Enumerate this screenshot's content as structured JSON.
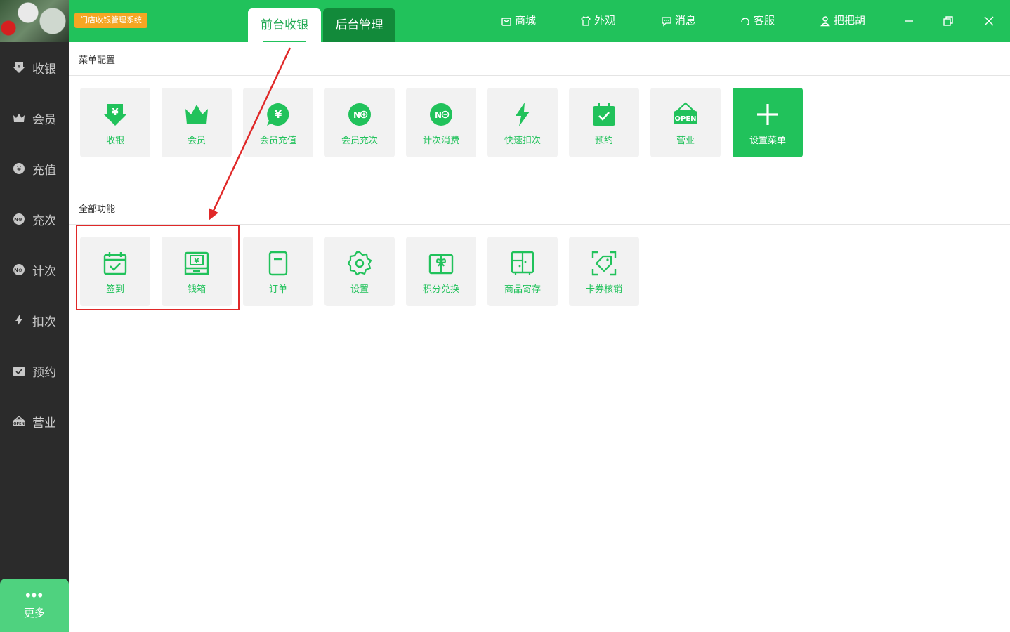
{
  "header": {
    "app_badge": "门店收银管理系统",
    "tabs": [
      {
        "label": "前台收银",
        "active": true
      },
      {
        "label": "后台管理",
        "active": false
      }
    ],
    "nav": [
      {
        "label": "商城",
        "icon": "bag-icon"
      },
      {
        "label": "外观",
        "icon": "shirt-icon"
      },
      {
        "label": "消息",
        "icon": "chat-icon"
      },
      {
        "label": "客服",
        "icon": "headset-icon"
      },
      {
        "label": "把把胡",
        "icon": "user-icon"
      }
    ]
  },
  "sidebar": {
    "items": [
      {
        "label": "收银",
        "icon": "cash-down-icon"
      },
      {
        "label": "会员",
        "icon": "crown-icon"
      },
      {
        "label": "充值",
        "icon": "yuan-circle-icon"
      },
      {
        "label": "充次",
        "icon": "no-plus-icon"
      },
      {
        "label": "计次",
        "icon": "no-minus-icon"
      },
      {
        "label": "扣次",
        "icon": "lightning-icon"
      },
      {
        "label": "预约",
        "icon": "calendar-check-icon"
      },
      {
        "label": "营业",
        "icon": "open-sign-icon"
      }
    ],
    "more_label": "更多"
  },
  "menu_config": {
    "title": "菜单配置",
    "tiles": [
      {
        "label": "收银"
      },
      {
        "label": "会员"
      },
      {
        "label": "会员充值"
      },
      {
        "label": "会员充次"
      },
      {
        "label": "计次消费"
      },
      {
        "label": "快速扣次"
      },
      {
        "label": "预约"
      },
      {
        "label": "营业"
      }
    ],
    "add_label": "设置菜单"
  },
  "all_functions": {
    "title": "全部功能",
    "tiles": [
      {
        "label": "签到"
      },
      {
        "label": "钱箱"
      },
      {
        "label": "订单"
      },
      {
        "label": "设置"
      },
      {
        "label": "积分兑换"
      },
      {
        "label": "商品寄存"
      },
      {
        "label": "卡券核销"
      }
    ]
  },
  "colors": {
    "brand_green": "#21c25b",
    "dark_green": "#128a3a",
    "sidebar_bg": "#2b2b2b",
    "badge_orange": "#f5a623",
    "annotation_red": "#e02828"
  }
}
